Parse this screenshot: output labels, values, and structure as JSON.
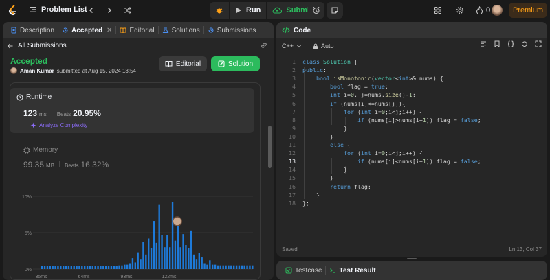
{
  "nav": {
    "title": "Problem List",
    "run_label": "Run",
    "submit_label": "Submit",
    "streak_count": "0",
    "premium_label": "Premium"
  },
  "left_tabs": [
    {
      "label": "Description",
      "icon": "description-icon"
    },
    {
      "label": "Accepted",
      "icon": "history-icon",
      "active": true
    },
    {
      "label": "Editorial",
      "icon": "book-icon"
    },
    {
      "label": "Solutions",
      "icon": "flask-icon"
    },
    {
      "label": "Submissions",
      "icon": "history-icon"
    }
  ],
  "submission": {
    "back_label": "All Submissions",
    "status": "Accepted",
    "author": "Aman Kumar",
    "submitted_text": "submitted at Aug 15, 2024 13:54",
    "editorial_button": "Editorial",
    "solution_button": "Solution",
    "status_color": "#2cbb5d"
  },
  "runtime": {
    "title": "Runtime",
    "value": "123",
    "unit": "ms",
    "beats_label": "Beats",
    "beats_value": "20.95%",
    "analyze_label": "Analyze Complexity"
  },
  "memory": {
    "title": "Memory",
    "value": "99.35",
    "unit": "MB",
    "beats_label": "Beats",
    "beats_value": "16.32%"
  },
  "chart_data": {
    "type": "bar",
    "y_ticks": [
      "10%",
      "5%",
      "0%"
    ],
    "ylim": [
      0,
      10
    ],
    "x_ticks": [
      {
        "label": "35ms",
        "index": 0
      },
      {
        "label": "64ms",
        "index": 16
      },
      {
        "label": "93ms",
        "index": 32
      },
      {
        "label": "122ms",
        "index": 48
      }
    ],
    "values": [
      0.4,
      0.4,
      0.4,
      0.4,
      0.4,
      0.4,
      0.4,
      0.4,
      0.4,
      0.4,
      0.4,
      0.4,
      0.4,
      0.4,
      0.4,
      0.4,
      0.4,
      0.4,
      0.4,
      0.4,
      0.4,
      0.4,
      0.4,
      0.4,
      0.4,
      0.4,
      0.4,
      0.4,
      0.4,
      0.5,
      0.5,
      0.6,
      0.6,
      0.8,
      1.5,
      0.9,
      2.3,
      1.3,
      3.7,
      2.0,
      4.2,
      2.9,
      6.6,
      3.6,
      8.9,
      4.7,
      3.0,
      4.7,
      3.0,
      9.2,
      3.9,
      6.0,
      3.0,
      4.8,
      3.3,
      2.9,
      5.3,
      2.0,
      1.3,
      2.2,
      1.6,
      0.8,
      0.6,
      1.2,
      0.6,
      0.6,
      0.5,
      0.5,
      0.5,
      0.5,
      0.5,
      0.5,
      0.5,
      0.5,
      0.5,
      0.5,
      0.5,
      0.5,
      0.5,
      0.5
    ],
    "highlight_index": 49,
    "bar_color": "#1e7ad9",
    "grid": true
  },
  "code": {
    "title": "Code",
    "language": "C++",
    "mode": "Auto",
    "status": "Saved",
    "cursor": "Ln 13, Col 37",
    "current_line": 13,
    "lines": [
      {
        "n": "1",
        "html": "<span class=\"kw\">class</span> <span class=\"ty\">Solution</span> {"
      },
      {
        "n": "2",
        "html": "<span class=\"kw\">public</span>:"
      },
      {
        "n": "3",
        "html": "    <span class=\"kw\">bool</span> <span class=\"fn\">isMonotonic</span>(<span class=\"ty\">vector</span>&lt;<span class=\"kw\">int</span>&gt;&amp; nums) {"
      },
      {
        "n": "4",
        "html": "        <span class=\"kw\">bool</span> flag = <span class=\"kw\">true</span>;"
      },
      {
        "n": "5",
        "html": "        <span class=\"kw\">int</span> i=<span class=\"nm\">0</span>, j=nums.<span class=\"fn\">size</span>()-<span class=\"nm\">1</span>;"
      },
      {
        "n": "6",
        "html": "        <span class=\"kw\">if</span> (nums[i]&lt;=nums[j]){"
      },
      {
        "n": "7",
        "html": "            <span class=\"kw\">for</span> (<span class=\"kw\">int</span> i=<span class=\"nm\">0</span>;i&lt;j;i++) {"
      },
      {
        "n": "8",
        "html": "                <span class=\"kw\">if</span> (nums[i]&gt;nums[i+<span class=\"nm\">1</span>]) flag = <span class=\"kw\">false</span>;"
      },
      {
        "n": "9",
        "html": "            }"
      },
      {
        "n": "10",
        "html": "        }"
      },
      {
        "n": "11",
        "html": "        <span class=\"kw\">else</span> {"
      },
      {
        "n": "12",
        "html": "            <span class=\"kw\">for</span> (<span class=\"kw\">int</span> i=<span class=\"nm\">0</span>;i&lt;j;i++) {"
      },
      {
        "n": "13",
        "html": "                <span class=\"kw\">if</span> (nums[i]&lt;nums[i+<span class=\"nm\">1</span>]) flag = <span class=\"kw\">false</span>;"
      },
      {
        "n": "14",
        "html": "            }"
      },
      {
        "n": "15",
        "html": "        }"
      },
      {
        "n": "16",
        "html": "        <span class=\"kw\">return</span> flag;"
      },
      {
        "n": "17",
        "html": "    }"
      },
      {
        "n": "18",
        "html": "};"
      }
    ]
  },
  "bottom_tabs": [
    {
      "label": "Testcase",
      "icon": "checkbox-icon"
    },
    {
      "label": "Test Result",
      "icon": "terminal-icon",
      "active": true
    }
  ]
}
